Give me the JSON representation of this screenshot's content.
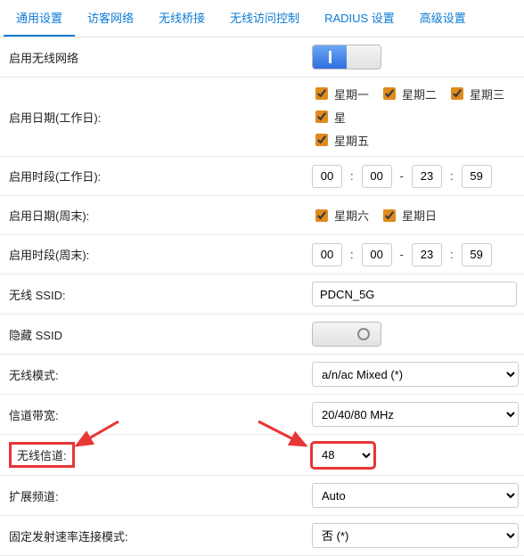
{
  "tabs": {
    "t0": "通用设置",
    "t1": "访客网络",
    "t2": "无线桥接",
    "t3": "无线访问控制",
    "t4": "RADIUS 设置",
    "t5": "高级设置"
  },
  "rows": {
    "enable_wireless": "启用无线网络",
    "days_workday": "启用日期(工作日):",
    "time_workday": "启用时段(工作日):",
    "days_weekend": "启用日期(周末):",
    "time_weekend": "启用时段(周末):",
    "ssid": "无线 SSID:",
    "hide_ssid": "隐藏 SSID",
    "mode": "无线模式:",
    "bandwidth": "信道带宽:",
    "channel": "无线信道:",
    "ext_channel": "扩展频道:",
    "fixed_rate": "固定发射速率连接模式:"
  },
  "days": {
    "mon": "星期一",
    "tue": "星期二",
    "wed": "星期三",
    "thu": "星",
    "fri": "星期五",
    "sat": "星期六",
    "sun": "星期日"
  },
  "times": {
    "wd_h1": "00",
    "wd_m1": "00",
    "wd_h2": "23",
    "wd_m2": "59",
    "we_h1": "00",
    "we_m1": "00",
    "we_h2": "23",
    "we_m2": "59"
  },
  "values": {
    "ssid": "PDCN_5G",
    "mode": "a/n/ac Mixed (*)",
    "bandwidth": "20/40/80 MHz",
    "channel": "48",
    "ext_channel": "Auto",
    "fixed_rate": "否 (*)"
  }
}
